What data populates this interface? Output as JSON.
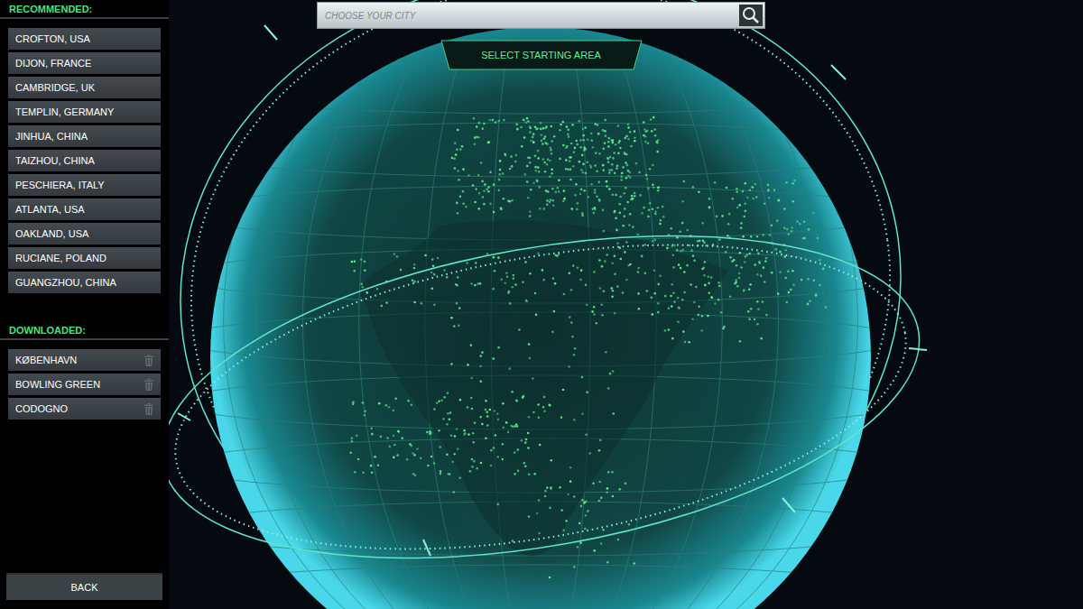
{
  "sidebar": {
    "recommended_heading": "RECOMMENDED:",
    "recommended": [
      {
        "label": "CROFTON, USA"
      },
      {
        "label": "DIJON, FRANCE"
      },
      {
        "label": "CAMBRIDGE, UK"
      },
      {
        "label": "TEMPLIN, GERMANY"
      },
      {
        "label": "JINHUA, CHINA"
      },
      {
        "label": "TAIZHOU, CHINA"
      },
      {
        "label": "PESCHIERA, ITALY"
      },
      {
        "label": "ATLANTA, USA"
      },
      {
        "label": "OAKLAND, USA"
      },
      {
        "label": "RUCIANE, POLAND"
      },
      {
        "label": "GUANGZHOU, CHINA"
      }
    ],
    "downloaded_heading": "DOWNLOADED:",
    "downloaded": [
      {
        "label": "KØBENHAVN"
      },
      {
        "label": "BOWLING GREEN"
      },
      {
        "label": "CODOGNO"
      }
    ],
    "back_button": "BACK"
  },
  "search": {
    "placeholder": "CHOOSE YOUR CITY"
  },
  "title": "SELECT STARTING AREA"
}
